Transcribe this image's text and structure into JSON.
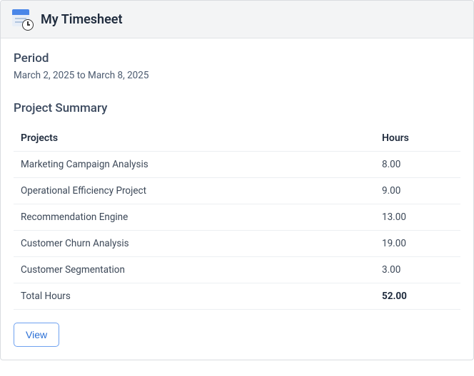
{
  "header": {
    "title": "My Timesheet"
  },
  "period": {
    "label": "Period",
    "value": "March 2, 2025 to March 8, 2025"
  },
  "summary": {
    "title": "Project Summary",
    "columns": {
      "projects": "Projects",
      "hours": "Hours"
    },
    "rows": [
      {
        "project": "Marketing Campaign Analysis",
        "hours": "8.00"
      },
      {
        "project": "Operational Efficiency Project",
        "hours": "9.00"
      },
      {
        "project": "Recommendation Engine",
        "hours": "13.00"
      },
      {
        "project": "Customer Churn Analysis",
        "hours": "19.00"
      },
      {
        "project": "Customer Segmentation",
        "hours": "3.00"
      }
    ],
    "total": {
      "label": "Total Hours",
      "hours": "52.00"
    }
  },
  "actions": {
    "view_label": "View"
  }
}
